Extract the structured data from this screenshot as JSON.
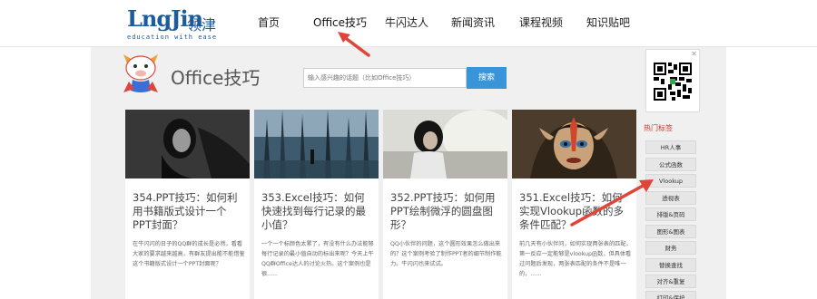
{
  "logo": {
    "brand": "LngJin",
    "cn": "领津",
    "tagline": "education with ease"
  },
  "nav": [
    "首页",
    "Office技巧",
    "牛闪达人",
    "新闻资讯",
    "课程视频",
    "知识贴吧"
  ],
  "section": {
    "title": "Office技巧"
  },
  "search": {
    "placeholder": "输入感兴趣的话题（比如Office技巧）",
    "button": "搜索"
  },
  "cards": [
    {
      "title": "354.PPT技巧：如何利用书籍版式设计一个PPT封面？",
      "desc": "在牛闪闪的日子的QQ群的成长是必然，看看大家的要求越来越高，有群友提出能不能借鉴这个书籍版式设计一个PPT封面呢？"
    },
    {
      "title": "353.Excel技巧：如何快速找到每行记录的最小值？",
      "desc": "一个一个标颜色太累了，有没有什么办法能够每行记录的最小值自动的标出来呢？今天上午QQ群Office达人的讨论火热。这个案例也是很......"
    },
    {
      "title": "352.PPT技巧：如何用PPT绘制微浮的圆盘图形？",
      "desc": "QQ小伙伴的问题，这个圆形效果怎么做出来的？这个案例考验了制作PPT者的细节制作能力。牛闪闪也来试试。"
    },
    {
      "title": "351.Excel技巧：如何实现Vlookup函数的多条件匹配？",
      "desc": "前几天有小伙伴问，如何实现两张表的匹配，第一反应一定能够是vlookup函数，但具体看过问题后发现，两张表匹配的条件不是唯一的，......"
    }
  ],
  "sidebar": {
    "hot_label": "热门标签",
    "tags": [
      "HR人事",
      "公式函数",
      "Vlookup",
      "透视表",
      "排版&页码",
      "图形&图表",
      "财务",
      "替换查找",
      "对齐&重复",
      "打印&保护"
    ]
  },
  "colors": {
    "accent": "#3a95d8",
    "brand": "#1c5b9c",
    "arrow": "#e0453a",
    "hot": "#c0392b"
  }
}
